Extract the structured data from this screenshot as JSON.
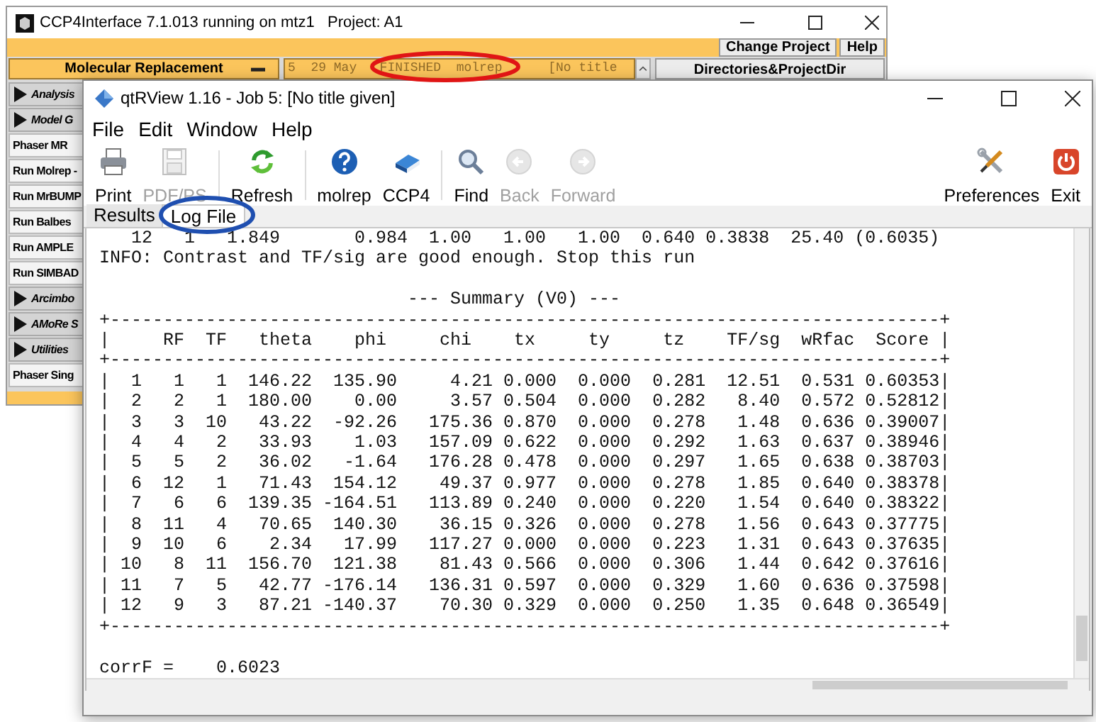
{
  "back_window": {
    "title": "CCP4Interface 7.1.013 running on mtz1   Project: A1",
    "top_buttons": [
      "Change Project",
      "Help"
    ],
    "module_button": "Molecular Replacement",
    "job_list": {
      "text": "5  29 May   FINISHED  molrep      [No title"
    },
    "directories_button": "Directories&ProjectDir",
    "sidebar": [
      {
        "kind": "group",
        "label": "Analysis"
      },
      {
        "kind": "group",
        "label": "Model G"
      },
      {
        "kind": "item",
        "label": "Phaser MR"
      },
      {
        "kind": "item",
        "label": "Run Molrep -"
      },
      {
        "kind": "item",
        "label": "Run MrBUMP"
      },
      {
        "kind": "item",
        "label": "Run Balbes"
      },
      {
        "kind": "item",
        "label": "Run AMPLE"
      },
      {
        "kind": "item",
        "label": "Run SIMBAD"
      },
      {
        "kind": "group",
        "label": "Arcimbo"
      },
      {
        "kind": "group",
        "label": "AMoRe S"
      },
      {
        "kind": "group",
        "label": "Utilities"
      },
      {
        "kind": "item",
        "label": "Phaser Sing"
      }
    ]
  },
  "front_window": {
    "title": "qtRView 1.16 - Job 5: [No title given]",
    "menu": [
      "File",
      "Edit",
      "Window",
      "Help"
    ],
    "toolbar": {
      "groups": [
        [
          {
            "label": "Print",
            "disabled": false
          },
          {
            "label": "PDF/PS",
            "disabled": true
          }
        ],
        [
          {
            "label": "Refresh",
            "disabled": false
          }
        ],
        [
          {
            "label": "molrep",
            "disabled": false
          },
          {
            "label": "CCP4",
            "disabled": false
          }
        ],
        [
          {
            "label": "Find",
            "disabled": false
          },
          {
            "label": "Back",
            "disabled": true
          },
          {
            "label": "Forward",
            "disabled": true
          }
        ]
      ],
      "right": [
        {
          "label": "Preferences",
          "disabled": false
        },
        {
          "label": "Exit",
          "disabled": false
        }
      ]
    },
    "tabs": [
      {
        "label": "Results",
        "selected": false
      },
      {
        "label": "Log File",
        "selected": true
      }
    ],
    "log_lines": [
      {
        "kind": "line",
        "text": "   12   1   1.849       0.984  1.00   1.00   1.00  0.640 0.3838  25.40 (0.6035)"
      },
      {
        "kind": "line",
        "text": "INFO: Contrast and TF/sig are good enough. Stop this run"
      },
      {
        "kind": "blank"
      },
      {
        "kind": "line",
        "text": "                             --- Summary (V0) ---"
      },
      {
        "kind": "line",
        "text": "+------------------------------------------------------------------------------+"
      },
      {
        "kind": "line",
        "text": "|     RF  TF   theta    phi     chi    tx     ty     tz    TF/sg  wRfac  Score |"
      },
      {
        "kind": "line",
        "text": "+------------------------------------------------------------------------------+"
      },
      {
        "kind": "line",
        "text": "|  1   1   1  146.22  135.90     4.21 0.000  0.000  0.281  12.51  0.531 0.60353|"
      },
      {
        "kind": "line",
        "text": "|  2   2   1  180.00    0.00     3.57 0.504  0.000  0.282   8.40  0.572 0.52812|"
      },
      {
        "kind": "line",
        "text": "|  3   3  10   43.22  -92.26   175.36 0.870  0.000  0.278   1.48  0.636 0.39007|"
      },
      {
        "kind": "line",
        "text": "|  4   4   2   33.93    1.03   157.09 0.622  0.000  0.292   1.63  0.637 0.38946|"
      },
      {
        "kind": "line",
        "text": "|  5   5   2   36.02   -1.64   176.28 0.478  0.000  0.297   1.65  0.638 0.38703|"
      },
      {
        "kind": "line",
        "text": "|  6  12   1   71.43  154.12    49.37 0.977  0.000  0.278   1.85  0.640 0.38378|"
      },
      {
        "kind": "line",
        "text": "|  7   6   6  139.35 -164.51   113.89 0.240  0.000  0.220   1.54  0.640 0.38322|"
      },
      {
        "kind": "line",
        "text": "|  8  11   4   70.65  140.30    36.15 0.326  0.000  0.278   1.56  0.643 0.37775|"
      },
      {
        "kind": "line",
        "text": "|  9  10   6    2.34   17.99   117.27 0.000  0.000  0.223   1.31  0.643 0.37635|"
      },
      {
        "kind": "line",
        "text": "| 10   8  11  156.70  121.38    81.43 0.566  0.000  0.306   1.44  0.642 0.37616|"
      },
      {
        "kind": "line",
        "text": "| 11   7   5   42.77 -176.14   136.31 0.597  0.000  0.329   1.60  0.636 0.37598|"
      },
      {
        "kind": "line",
        "text": "| 12   9   3   87.21 -140.37    70.30 0.329  0.000  0.250   1.35  0.648 0.36549|"
      },
      {
        "kind": "line",
        "text": "+------------------------------------------------------------------------------+"
      },
      {
        "kind": "blank"
      },
      {
        "kind": "line",
        "text": "corrF =    0.6023"
      }
    ]
  },
  "annotations": [
    {
      "kind": "ellipse",
      "color": "#e01515"
    },
    {
      "kind": "ellipse",
      "color": "#1f4fb0"
    }
  ]
}
